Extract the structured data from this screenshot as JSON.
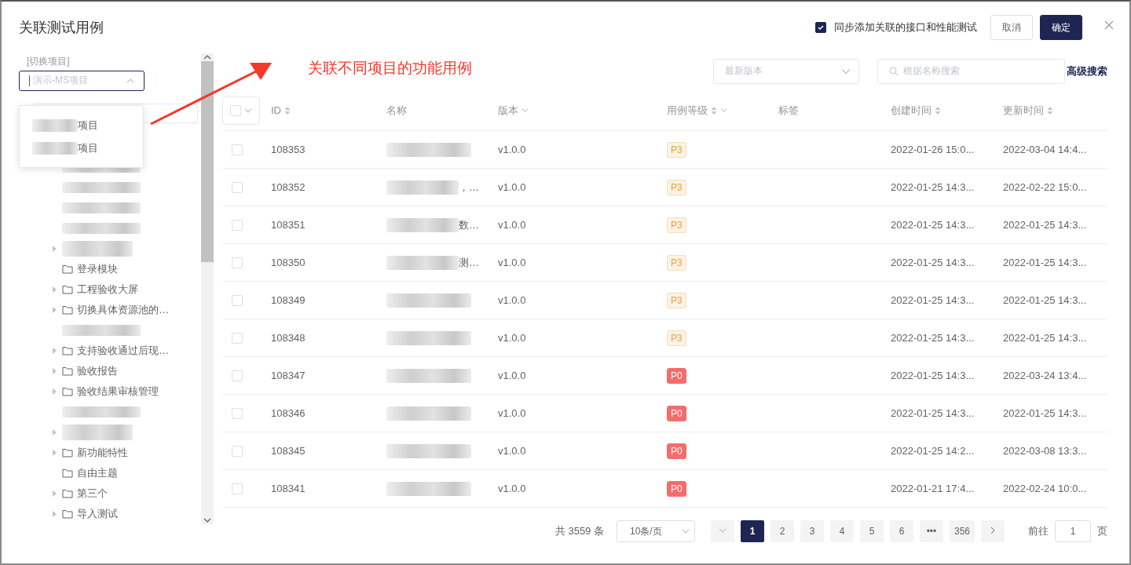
{
  "dialog": {
    "title": "关联测试用例",
    "sync_option": {
      "label": "同步添加关联的接口和性能测试",
      "checked": true
    },
    "buttons": [
      {
        "label": "取消",
        "kind": "secondary"
      },
      {
        "label": "确定",
        "kind": "primary"
      }
    ]
  },
  "annotation": {
    "text": "关联不同项目的功能用例"
  },
  "project_switch": {
    "label": "[切换项目]",
    "value": "演示-MS项目",
    "expanded": true,
    "options": [
      {
        "label": "项目",
        "redacted_prefix": true
      },
      {
        "label": "项目",
        "redacted_prefix": true
      }
    ]
  },
  "tree": [
    {
      "kind": "redacted",
      "expandable": false
    },
    {
      "kind": "redacted",
      "expandable": false
    },
    {
      "kind": "redacted",
      "expandable": false
    },
    {
      "kind": "redacted",
      "expandable": false
    },
    {
      "kind": "redacted",
      "expandable": true
    },
    {
      "kind": "folder",
      "label": "登录模块",
      "expandable": false
    },
    {
      "kind": "folder",
      "label": "工程验收大屏",
      "expandable": true
    },
    {
      "kind": "folder",
      "label": "切换具体资源池的…",
      "expandable": true
    },
    {
      "kind": "redacted",
      "expandable": false
    },
    {
      "kind": "folder",
      "label": "支持验收通过后现…",
      "expandable": true
    },
    {
      "kind": "folder",
      "label": "验收报告",
      "expandable": true
    },
    {
      "kind": "folder",
      "label": "验收结果审核管理",
      "expandable": true
    },
    {
      "kind": "redacted",
      "expandable": false
    },
    {
      "kind": "redacted",
      "expandable": true
    },
    {
      "kind": "folder",
      "label": "新功能特性",
      "expandable": true
    },
    {
      "kind": "folder",
      "label": "自由主题",
      "expandable": false
    },
    {
      "kind": "folder",
      "label": "第三个",
      "expandable": true
    },
    {
      "kind": "folder",
      "label": "导入测试",
      "expandable": true
    }
  ],
  "filters": {
    "version_placeholder": "最新版本",
    "search_placeholder": "根据名称搜索",
    "advanced_link": "高级搜索"
  },
  "table": {
    "select_all_checked": false,
    "columns": [
      {
        "label": "ID",
        "sortable": true,
        "filter": false
      },
      {
        "label": "名称",
        "sortable": false,
        "filter": false
      },
      {
        "label": "版本",
        "sortable": false,
        "filter": true
      },
      {
        "label": "用例等级",
        "sortable": true,
        "filter": true
      },
      {
        "label": "标签",
        "sortable": false,
        "filter": false
      },
      {
        "label": "创建时间",
        "sortable": true,
        "filter": false
      },
      {
        "label": "更新时间",
        "sortable": true,
        "filter": false
      }
    ],
    "rows": [
      {
        "id": "108353",
        "name_tail": "",
        "version": "v1.0.0",
        "priority": {
          "label": "P3",
          "kind": "light",
          "color": "#e6a23c"
        },
        "created": "2022-01-26 15:0...",
        "updated": "2022-03-04 14:4...",
        "checked": false
      },
      {
        "id": "108352",
        "name_tail": "，…",
        "version": "v1.0.0",
        "priority": {
          "label": "P3",
          "kind": "light",
          "color": "#e6a23c"
        },
        "created": "2022-01-25 14:3...",
        "updated": "2022-02-22 15:0...",
        "checked": false
      },
      {
        "id": "108351",
        "name_tail": "数…",
        "version": "v1.0.0",
        "priority": {
          "label": "P3",
          "kind": "light",
          "color": "#e6a23c"
        },
        "created": "2022-01-25 14:3...",
        "updated": "2022-01-25 14:3...",
        "checked": false
      },
      {
        "id": "108350",
        "name_tail": "测…",
        "version": "v1.0.0",
        "priority": {
          "label": "P3",
          "kind": "light",
          "color": "#e6a23c"
        },
        "created": "2022-01-25 14:3...",
        "updated": "2022-01-25 14:3...",
        "checked": false
      },
      {
        "id": "108349",
        "name_tail": "",
        "version": "v1.0.0",
        "priority": {
          "label": "P3",
          "kind": "light",
          "color": "#e6a23c"
        },
        "created": "2022-01-25 14:3...",
        "updated": "2022-01-25 14:3...",
        "checked": false
      },
      {
        "id": "108348",
        "name_tail": "",
        "version": "v1.0.0",
        "priority": {
          "label": "P3",
          "kind": "light",
          "color": "#e6a23c"
        },
        "created": "2022-01-25 14:3...",
        "updated": "2022-01-25 14:3...",
        "checked": false
      },
      {
        "id": "108347",
        "name_tail": "",
        "version": "v1.0.0",
        "priority": {
          "label": "P0",
          "kind": "solid",
          "color": "#f56c6c"
        },
        "created": "2022-01-25 14:3...",
        "updated": "2022-03-24 13:4...",
        "checked": false
      },
      {
        "id": "108346",
        "name_tail": "",
        "version": "v1.0.0",
        "priority": {
          "label": "P0",
          "kind": "solid",
          "color": "#f56c6c"
        },
        "created": "2022-01-25 14:3...",
        "updated": "2022-01-25 14:3...",
        "checked": false
      },
      {
        "id": "108345",
        "name_tail": "",
        "version": "v1.0.0",
        "priority": {
          "label": "P0",
          "kind": "solid",
          "color": "#f56c6c"
        },
        "created": "2022-01-25 14:2...",
        "updated": "2022-03-08 13:3...",
        "checked": false
      },
      {
        "id": "108341",
        "name_tail": "",
        "version": "v1.0.0",
        "priority": {
          "label": "P0",
          "kind": "solid",
          "color": "#f56c6c"
        },
        "created": "2022-01-21 17:4...",
        "updated": "2022-02-24 10:0...",
        "checked": false
      }
    ]
  },
  "pagination": {
    "total": "共 3559 条",
    "page_size": "10条/页",
    "pages": [
      {
        "label": "1",
        "selected": true
      },
      {
        "label": "2",
        "selected": false
      },
      {
        "label": "3",
        "selected": false
      },
      {
        "label": "4",
        "selected": false
      },
      {
        "label": "5",
        "selected": false
      },
      {
        "label": "6",
        "selected": false
      },
      {
        "label": "•••",
        "selected": false
      },
      {
        "label": "356",
        "selected": false
      }
    ],
    "goto_label": "前往",
    "goto_value": "1",
    "goto_suffix": "页"
  }
}
